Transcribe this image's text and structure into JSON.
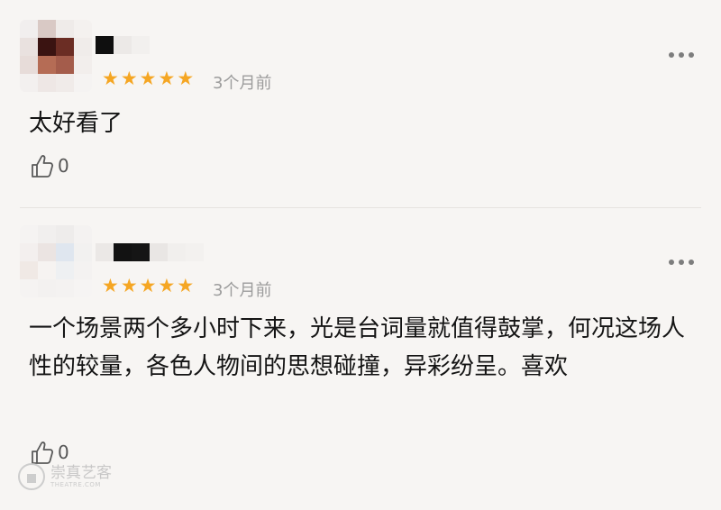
{
  "colors": {
    "star": "#f5a623",
    "background": "#f7f5f3",
    "time": "#9c9c9c"
  },
  "reviews": [
    {
      "stars": 5,
      "time": "3个月前",
      "content": "太好看了",
      "likes": "0",
      "icons": {
        "more": "more-dots-icon",
        "like": "thumb-up-icon"
      }
    },
    {
      "stars": 5,
      "time": "3个月前",
      "content": "一个场景两个多小时下来，光是台词量就值得鼓掌，何况这场人性的较量，各色人物间的思想碰撞，异彩纷呈。喜欢",
      "likes": "0",
      "icons": {
        "more": "more-dots-icon",
        "like": "thumb-up-icon"
      }
    }
  ],
  "watermark": {
    "text": "崇真艺客",
    "sub": "THEATRE.COM"
  }
}
